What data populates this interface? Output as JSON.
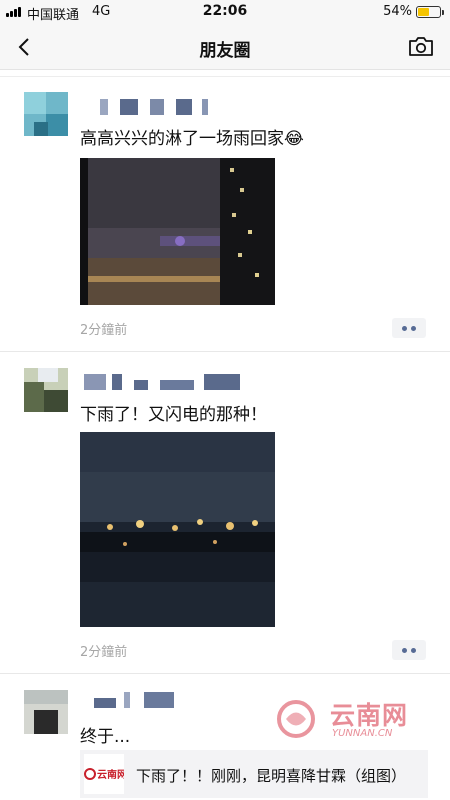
{
  "status_bar": {
    "carrier": "中国联通",
    "network": "4G",
    "time": "22:06",
    "battery_percent": "54%",
    "battery_level": 0.54
  },
  "nav": {
    "back_icon": "chevron-left-icon",
    "title": "朋友圈",
    "camera_icon": "camera-icon"
  },
  "posts": [
    {
      "text": "高高兴兴的淋了一场雨回家😂",
      "time": "2分鐘前"
    },
    {
      "text": "下雨了！又闪电的那种！",
      "time": "2分鐘前"
    },
    {
      "text": "终于...",
      "share": {
        "logo_text": "云南网",
        "title": "下雨了！！刚刚，昆明喜降甘霖（组图）"
      }
    }
  ],
  "watermark": {
    "text": "云南网",
    "subtext": "YUNNAN.CN"
  },
  "colors": {
    "link_blue": "#576b95",
    "timestamp_gray": "#a6a6a6",
    "watermark_pink": "#e47a86"
  }
}
